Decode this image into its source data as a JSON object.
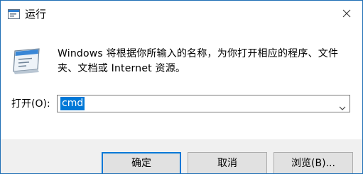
{
  "window": {
    "title": "运行",
    "title_icon": "run-app-icon",
    "close_icon": "close-icon"
  },
  "main": {
    "description": "Windows 将根据你所输入的名称，为你打开相应的程序、文件夹、文档或 Internet 资源。",
    "open_label": "打开(O):",
    "open_value": "cmd",
    "dropdown_icon": "chevron-down-icon"
  },
  "buttons": {
    "ok_label": "确定",
    "cancel_label": "取消",
    "browse_label": "浏览(B)..."
  },
  "colors": {
    "accent": "#0078d7",
    "window_border": "#1f6fb5",
    "footer_bg": "#f0f0f0"
  }
}
